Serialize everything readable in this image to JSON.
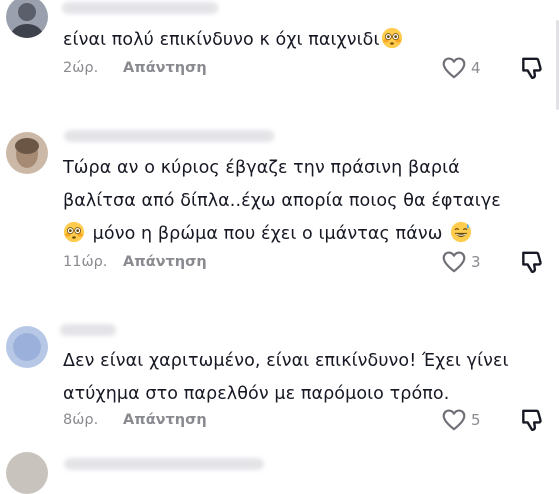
{
  "comments": [
    {
      "text": "είναι πολύ επικίνδυνο κ όχι παιχνιδι",
      "time": "2ώρ.",
      "reply_label": "Απάντηση",
      "likes": "4",
      "emoji": "flushed-face-emoji"
    },
    {
      "line1": "Τώρα αν ο κύριος έβγαζε την πράσινη βαριά",
      "line2": "βαλίτσα από δίπλα..έχω απορία ποιος θα έφταιγε",
      "line3": "μόνο η βρώμα που έχει ο ιμάντας πάνω",
      "time": "11ώρ.",
      "reply_label": "Απάντηση",
      "likes": "3",
      "emojis": [
        "flushed-face-emoji",
        "grinning-sweat-emoji"
      ]
    },
    {
      "line1": "Δεν είναι χαριτωμένο, είναι επικίνδυνο! Έχει γίνει",
      "line2": "ατύχημα στο παρελθόν με παρόμοιο τρόπο.",
      "time": "8ώρ.",
      "reply_label": "Απάντηση",
      "likes": "5"
    }
  ],
  "colors": {
    "text": "#161823",
    "meta": "#8a8b91"
  }
}
